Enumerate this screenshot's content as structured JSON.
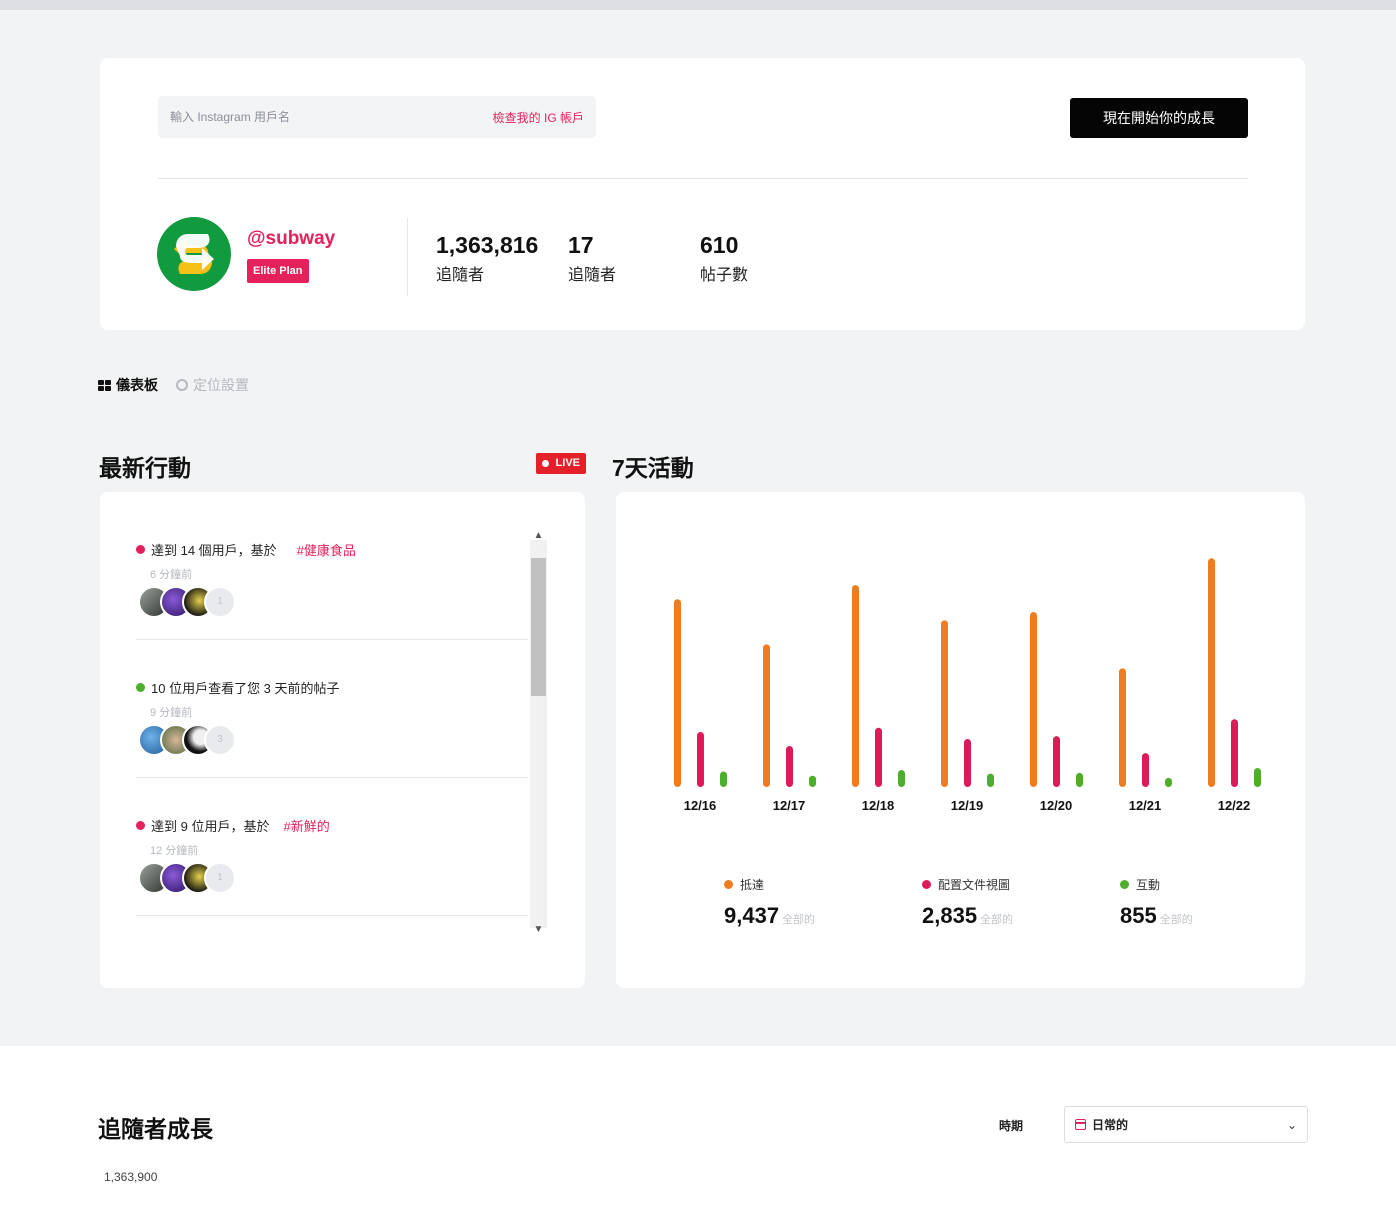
{
  "search": {
    "placeholder": "輸入 Instagram 用戶名",
    "check_link": "檢查我的 IG 帳戶"
  },
  "cta": {
    "label": "現在開始你的成長"
  },
  "profile": {
    "handle": "@subway",
    "plan": "Elite Plan",
    "logo_colors": {
      "ring": "#119a3e",
      "arrow_white": "#ffffff",
      "arrow_yellow": "#f4c116"
    },
    "stats": [
      {
        "value": "1,363,816",
        "label": "追隨者"
      },
      {
        "value": "17",
        "label": "追隨者"
      },
      {
        "value": "610",
        "label": "帖子數"
      }
    ]
  },
  "tabs": [
    {
      "label": "儀表板",
      "icon": "grid-icon",
      "active": true
    },
    {
      "label": "定位設置",
      "icon": "ring-icon",
      "active": false
    }
  ],
  "activity": {
    "title": "最新行動",
    "live": "LIVE",
    "items": [
      {
        "dot_color": "#e4215a",
        "text": "達到 14 個用戶，基於",
        "hashtag": "#健康食品",
        "time": "6 分鐘前",
        "more": "1"
      },
      {
        "dot_color": "#4cae2a",
        "text": "10 位用戶查看了您 3 天前的帖子",
        "hashtag": "",
        "time": "9 分鐘前",
        "more": "3"
      },
      {
        "dot_color": "#e4215a",
        "text": "達到 9 位用戶，基於",
        "hashtag": "#新鮮的",
        "time": "12 分鐘前",
        "more": "1"
      }
    ]
  },
  "chart": {
    "title": "7天活動",
    "colors": {
      "reach": "#f07c1f",
      "profile": "#de1b59",
      "engage": "#4cae2a"
    },
    "legend": [
      {
        "label": "抵達",
        "value": "9,437",
        "unit": "全部的"
      },
      {
        "label": "配置文件視圖",
        "value": "2,835",
        "unit": "全部的"
      },
      {
        "label": "互動",
        "value": "855",
        "unit": "全部的"
      }
    ]
  },
  "chart_data": {
    "type": "bar",
    "title": "7天活動",
    "categories": [
      "12/16",
      "12/17",
      "12/18",
      "12/19",
      "12/20",
      "12/21",
      "12/22"
    ],
    "series": [
      {
        "name": "抵達",
        "values": [
          1330,
          1010,
          1430,
          1180,
          1240,
          840,
          1620
        ]
      },
      {
        "name": "配置文件視圖",
        "values": [
          390,
          290,
          420,
          340,
          360,
          240,
          480
        ]
      },
      {
        "name": "互動",
        "values": [
          110,
          80,
          120,
          95,
          100,
          65,
          135
        ]
      }
    ],
    "ylim": [
      0,
      1700
    ],
    "grid": false,
    "legend_position": "bottom"
  },
  "followers": {
    "title": "追隨者成長",
    "period_label": "時期",
    "period_value": "日常的",
    "y_tick": "1,363,900"
  }
}
